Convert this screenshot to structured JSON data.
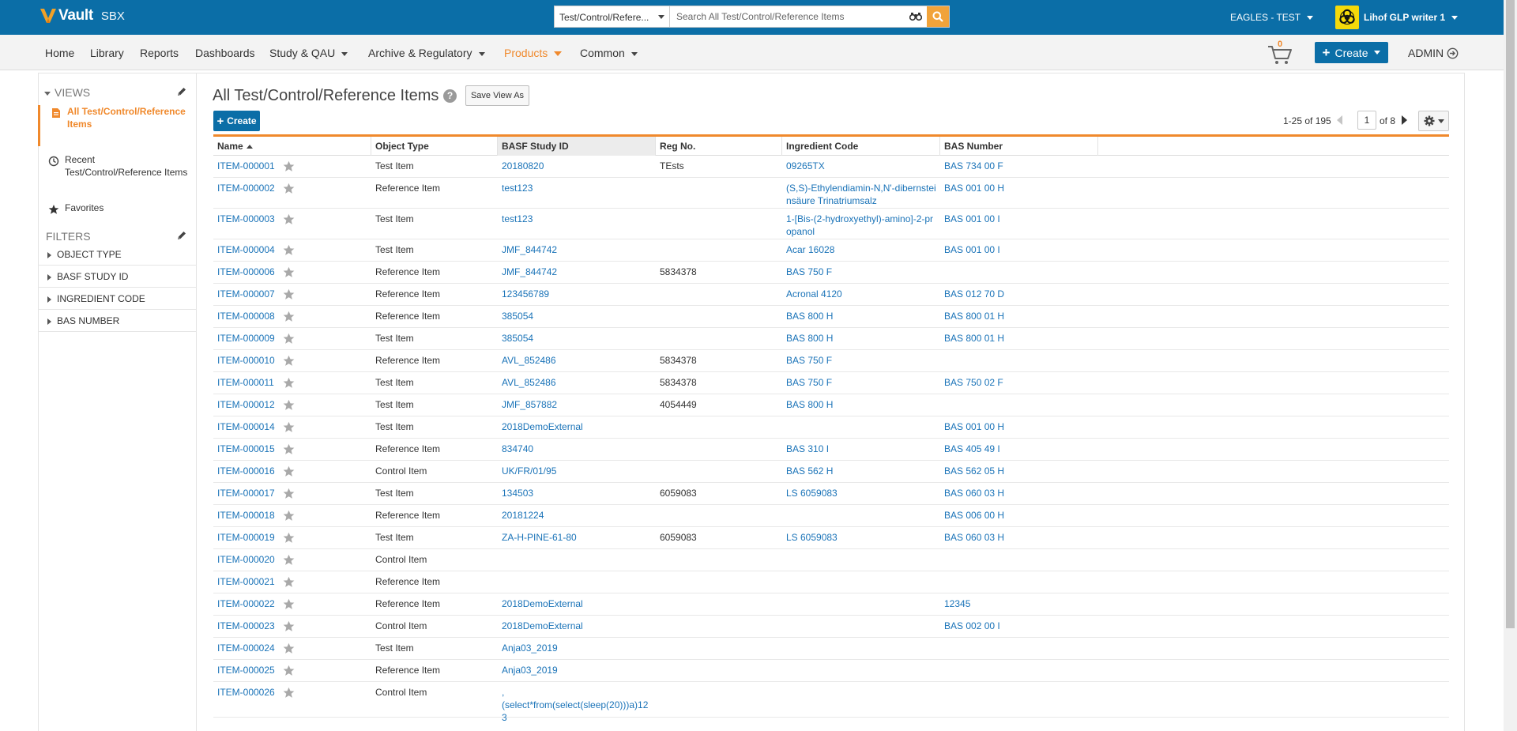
{
  "app": {
    "brand": "Vault",
    "env": "SBX",
    "search_scope": "Test/Control/Refere...",
    "search_placeholder": "Search All Test/Control/Reference Items",
    "vault_name": "EAGLES - TEST",
    "user_name": "Lihof GLP writer 1"
  },
  "nav": {
    "items": [
      "Home",
      "Library",
      "Reports",
      "Dashboards",
      "Study & QAU",
      "Archive & Regulatory",
      "Products",
      "Common"
    ],
    "active": "Products",
    "cart_count": "0",
    "create_label": "Create",
    "admin_label": "ADMIN"
  },
  "sidebar": {
    "views_label": "VIEWS",
    "views": [
      {
        "label": "All Test/Control/Reference Items",
        "icon": "document-icon",
        "active": true
      },
      {
        "label": "Recent Test/Control/Reference Items",
        "icon": "clock-icon",
        "active": false
      },
      {
        "label": "Favorites",
        "icon": "star-icon",
        "active": false
      }
    ],
    "filters_label": "FILTERS",
    "filters": [
      "OBJECT TYPE",
      "BASF STUDY ID",
      "INGREDIENT CODE",
      "BAS NUMBER"
    ]
  },
  "main": {
    "title": "All Test/Control/Reference Items",
    "save_view_label": "Save View As",
    "create_label": "Create",
    "pager_range": "1-25 of 195",
    "pager_page": "1",
    "pager_of": "of 8"
  },
  "table": {
    "columns": [
      "Name",
      "Object Type",
      "BASF Study ID",
      "Reg No.",
      "Ingredient Code",
      "BAS Number"
    ],
    "rows": [
      {
        "name": "ITEM-000001",
        "type": "Test Item",
        "study": "20180820",
        "reg": "TEsts",
        "ingredient": "09265TX",
        "bas": "BAS 734 00 F"
      },
      {
        "name": "ITEM-000002",
        "type": "Reference Item",
        "study": "test123",
        "reg": "",
        "ingredient": "(S,S)-Ethylendiamin-N,N'-dibernsteinsäure Trinatriumsalz",
        "bas": "BAS 001 00 H"
      },
      {
        "name": "ITEM-000003",
        "type": "Test Item",
        "study": "test123",
        "reg": "",
        "ingredient": "1-[Bis-(2-hydroxyethyl)-amino]-2-propanol",
        "bas": "BAS 001 00 I"
      },
      {
        "name": "ITEM-000004",
        "type": "Test Item",
        "study": "JMF_844742",
        "reg": "",
        "ingredient": "Acar 16028",
        "bas": "BAS 001 00 I"
      },
      {
        "name": "ITEM-000006",
        "type": "Reference Item",
        "study": "JMF_844742",
        "reg": "5834378",
        "ingredient": "BAS 750 F",
        "bas": ""
      },
      {
        "name": "ITEM-000007",
        "type": "Reference Item",
        "study": "123456789",
        "reg": "",
        "ingredient": "Acronal 4120",
        "bas": "BAS 012 70 D"
      },
      {
        "name": "ITEM-000008",
        "type": "Reference Item",
        "study": "385054",
        "reg": "",
        "ingredient": "BAS 800 H",
        "bas": "BAS 800 01 H"
      },
      {
        "name": "ITEM-000009",
        "type": "Test Item",
        "study": "385054",
        "reg": "",
        "ingredient": "BAS 800 H",
        "bas": "BAS 800 01 H"
      },
      {
        "name": "ITEM-000010",
        "type": "Reference Item",
        "study": "AVL_852486",
        "reg": "5834378",
        "ingredient": "BAS 750 F",
        "bas": ""
      },
      {
        "name": "ITEM-000011",
        "type": "Test Item",
        "study": "AVL_852486",
        "reg": "5834378",
        "ingredient": "BAS 750 F",
        "bas": "BAS 750 02 F"
      },
      {
        "name": "ITEM-000012",
        "type": "Test Item",
        "study": "JMF_857882",
        "reg": "4054449",
        "ingredient": "BAS 800 H",
        "bas": ""
      },
      {
        "name": "ITEM-000014",
        "type": "Test Item",
        "study": "2018DemoExternal",
        "reg": "",
        "ingredient": "",
        "bas": "BAS 001 00 H"
      },
      {
        "name": "ITEM-000015",
        "type": "Reference Item",
        "study": "834740",
        "reg": "",
        "ingredient": "BAS 310 I",
        "bas": "BAS 405 49 I"
      },
      {
        "name": "ITEM-000016",
        "type": "Control Item",
        "study": "UK/FR/01/95",
        "reg": "",
        "ingredient": "BAS 562 H",
        "bas": "BAS 562 05 H"
      },
      {
        "name": "ITEM-000017",
        "type": "Test Item",
        "study": "134503",
        "reg": "6059083",
        "ingredient": "LS 6059083",
        "bas": "BAS 060 03 H"
      },
      {
        "name": "ITEM-000018",
        "type": "Reference Item",
        "study": "20181224",
        "reg": "",
        "ingredient": "",
        "bas": "BAS 006 00 H"
      },
      {
        "name": "ITEM-000019",
        "type": "Test Item",
        "study": "ZA-H-PINE-61-80",
        "reg": "6059083",
        "ingredient": "LS 6059083",
        "bas": "BAS 060 03 H"
      },
      {
        "name": "ITEM-000020",
        "type": "Control Item",
        "study": "",
        "reg": "",
        "ingredient": "",
        "bas": ""
      },
      {
        "name": "ITEM-000021",
        "type": "Reference Item",
        "study": "",
        "reg": "",
        "ingredient": "",
        "bas": ""
      },
      {
        "name": "ITEM-000022",
        "type": "Reference Item",
        "study": "2018DemoExternal",
        "reg": "",
        "ingredient": "",
        "bas": "12345"
      },
      {
        "name": "ITEM-000023",
        "type": "Control Item",
        "study": "2018DemoExternal",
        "reg": "",
        "ingredient": "",
        "bas": "BAS 002 00 I"
      },
      {
        "name": "ITEM-000024",
        "type": "Test Item",
        "study": "Anja03_2019",
        "reg": "",
        "ingredient": "",
        "bas": ""
      },
      {
        "name": "ITEM-000025",
        "type": "Reference Item",
        "study": "Anja03_2019",
        "reg": "",
        "ingredient": "",
        "bas": ""
      },
      {
        "name": "ITEM-000026",
        "type": "Control Item",
        "study": ",\n(select*from(select(sleep(20)))a)123",
        "reg": "",
        "ingredient": "",
        "bas": ""
      }
    ]
  },
  "colors": {
    "header_blue": "#0b6ea7",
    "accent_orange": "#f0892c",
    "search_orange": "#f1a33a",
    "link_blue": "#1a73b8"
  }
}
